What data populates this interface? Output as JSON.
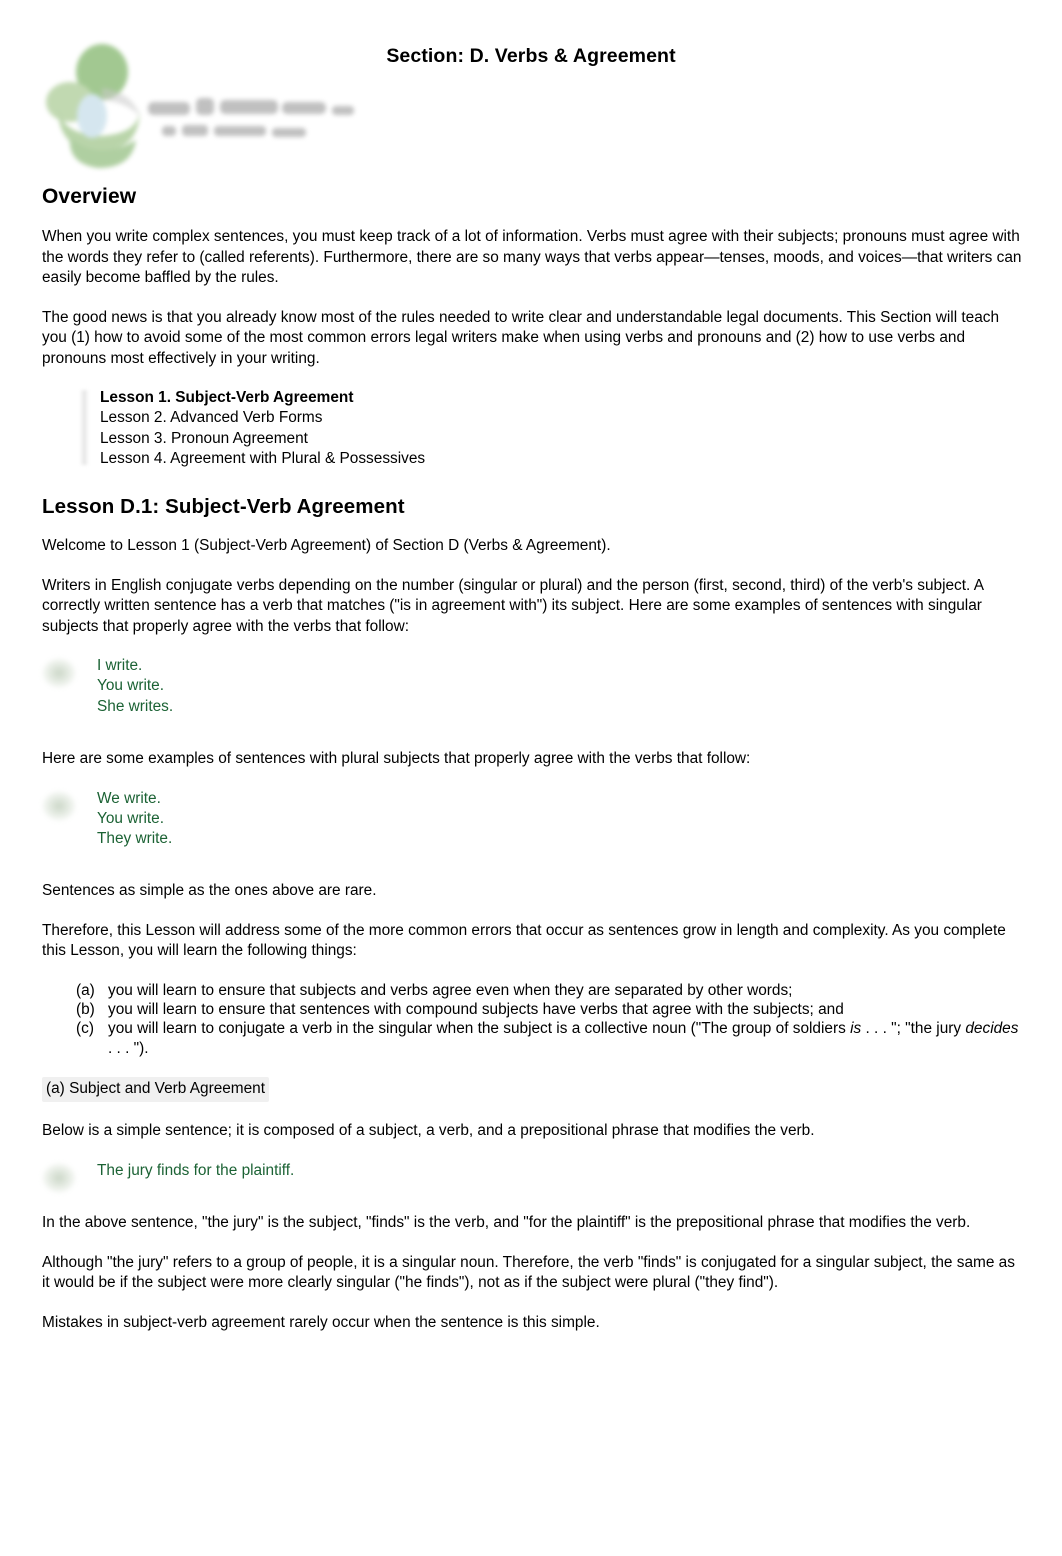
{
  "header": {
    "title": "Section: D. Verbs & Agreement",
    "logo_alt": "Core Grammar for Lawyers logo",
    "logo_colors": {
      "green": "#6aa84f",
      "light_green": "#a8c49a",
      "blue": "#bcd8e6",
      "text_grey": "#9a9a9a"
    }
  },
  "overview": {
    "heading": "Overview",
    "paragraph_1": "When you write complex sentences, you must keep track of a lot of information. Verbs must agree with their subjects; pronouns must agree with the words they refer to (called referents). Furthermore, there are so many ways that verbs appear—tenses, moods, and voices—that writers can easily become baffled by the rules.",
    "paragraph_2": "The good news is that you already know most of the rules needed to write clear and understandable legal documents. This Section will teach you (1) how to avoid some of the most common errors legal writers make when using verbs and pronouns and (2) how to use verbs and pronouns most effectively in your writing."
  },
  "lesson_list": [
    {
      "label": "Lesson 1. Subject-Verb Agreement",
      "bold": true
    },
    {
      "label": "Lesson 2. Advanced Verb Forms",
      "bold": false
    },
    {
      "label": "Lesson 3. Pronoun Agreement",
      "bold": false
    },
    {
      "label": "Lesson 4. Agreement with Plural & Possessives",
      "bold": false
    }
  ],
  "lesson": {
    "heading": "Lesson D.1: Subject-Verb Agreement",
    "welcome": "Welcome to Lesson 1 (Subject-Verb Agreement) of Section D (Verbs & Agreement).",
    "intro": "Writers in English conjugate verbs depending on the number (singular or plural) and the person (first, second, third) of the verb's subject. A correctly written sentence has a verb that matches (\"is in agreement with\") its subject. Here are some examples of sentences with singular subjects that properly agree with the verbs that follow:",
    "example_singular": [
      "I write.",
      "You write.",
      "She writes."
    ],
    "plural_lead": "Here are some examples of sentences with plural subjects that properly agree with the verbs that follow:",
    "example_plural": [
      "We write.",
      "You write.",
      "They write."
    ],
    "rare_note": "Sentences as simple as the ones above are rare.",
    "therefore": "Therefore, this Lesson will address some of the more common errors that occur as sentences grow in length and complexity. As you complete this Lesson, you will learn the following things:",
    "objectives": [
      {
        "marker": "(a)",
        "text": "you will learn to ensure that subjects and verbs agree even when they are separated by other words;"
      },
      {
        "marker": "(b)",
        "text": "you will learn to ensure that sentences with compound subjects have verbs that agree with the subjects; and"
      },
      {
        "marker": "(c)",
        "text_part_1": "you will learn to conjugate a verb in the singular when the subject is a collective noun (\"The group of soldiers ",
        "italic_1": "is",
        "text_part_2": " . . . \"; \"the jury ",
        "italic_2": "decides",
        "text_part_3": " . . . \")."
      }
    ],
    "subheading_a": "(a) Subject and Verb Agreement",
    "below_sentence": "Below is a simple sentence; it is composed of a subject, a verb, and a prepositional phrase that modifies the verb.",
    "example_jury": [
      "The jury finds for the plaintiff."
    ],
    "explain_1": "In the above sentence, \"the jury\" is the subject, \"finds\" is the verb, and \"for the plaintiff\" is the prepositional phrase that modifies the verb.",
    "explain_2": "Although \"the jury\" refers to a group of people, it is a singular noun. Therefore, the verb \"finds\" is conjugated for a singular subject, the same as it would be if the subject were more clearly singular (\"he finds\"), not as if the subject were plural (\"they find\").",
    "explain_3": "Mistakes in subject-verb agreement rarely occur when the sentence is this simple."
  },
  "colors": {
    "example_green": "#1b6234",
    "body_text": "#000000",
    "highlight_background": "#ececec",
    "quote_bar": "#aaaaaa"
  }
}
